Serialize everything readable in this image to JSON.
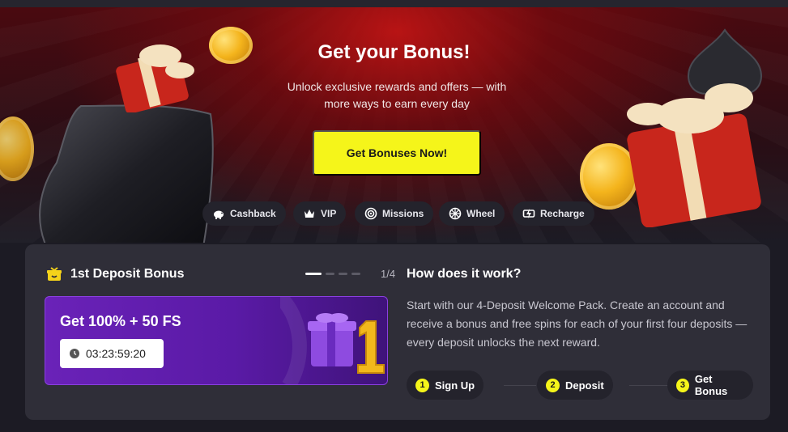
{
  "hero": {
    "title": "Get your Bonus!",
    "subtitle": "Unlock exclusive rewards and offers — with more ways to earn every day",
    "cta_label": "Get Bonuses Now!",
    "chips": [
      {
        "label": "Cashback",
        "icon": "piggy-bank-icon"
      },
      {
        "label": "VIP",
        "icon": "crown-icon"
      },
      {
        "label": "Missions",
        "icon": "target-icon"
      },
      {
        "label": "Wheel",
        "icon": "wheel-icon"
      },
      {
        "label": "Recharge",
        "icon": "recharge-icon"
      }
    ]
  },
  "bonus": {
    "title": "1st Deposit Bonus",
    "pager": "1/4",
    "promo_title": "Get 100% + 50 FS",
    "timer": "03:23:59:20"
  },
  "how": {
    "title": "How does it work?",
    "text": "Start with our 4-Deposit Welcome Pack. Create an account and receive a bonus and free spins for each of your first four deposits — every deposit unlocks the next reward.",
    "steps": [
      {
        "num": "1",
        "label": "Sign Up"
      },
      {
        "num": "2",
        "label": "Deposit"
      },
      {
        "num": "3",
        "label": "Get Bonus"
      }
    ]
  },
  "colors": {
    "accent_yellow": "#f5f51a",
    "promo_purple": "#6a22b8",
    "panel": "#2f2e38",
    "hero_red": "#be1414"
  }
}
